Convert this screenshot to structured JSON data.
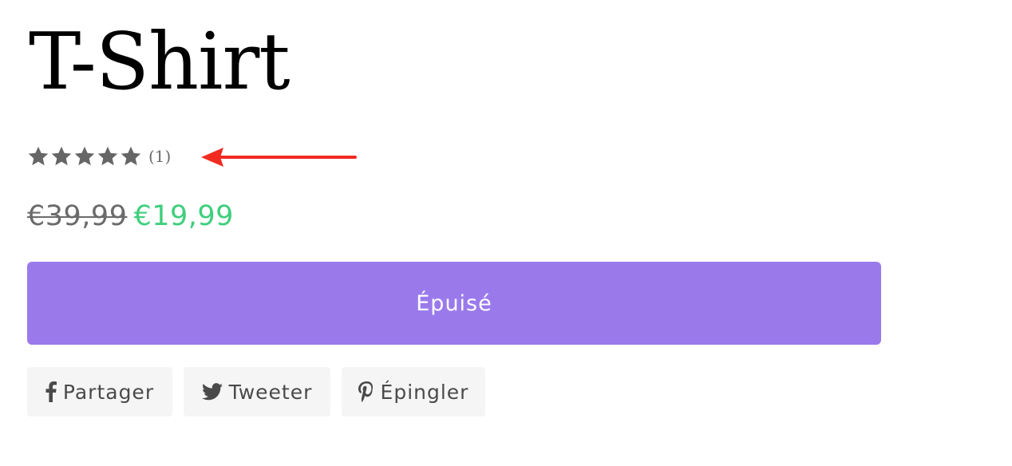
{
  "product": {
    "title": "T-Shirt",
    "rating": {
      "value": 5,
      "max": 5,
      "review_count_label": "(1)",
      "star_color": "#666666"
    },
    "compare_at_price": "€39,99",
    "sale_price": "€19,99",
    "sale_price_color": "#3fcf7d",
    "sold_out_button": {
      "label": "Épuisé",
      "color": "#9a7aeb"
    }
  },
  "annotation": {
    "arrow_color": "#f22b22"
  },
  "share": {
    "facebook": {
      "label": "Partager",
      "icon": "facebook-icon"
    },
    "twitter": {
      "label": "Tweeter",
      "icon": "twitter-icon"
    },
    "pinterest": {
      "label": "Épingler",
      "icon": "pinterest-icon"
    }
  }
}
